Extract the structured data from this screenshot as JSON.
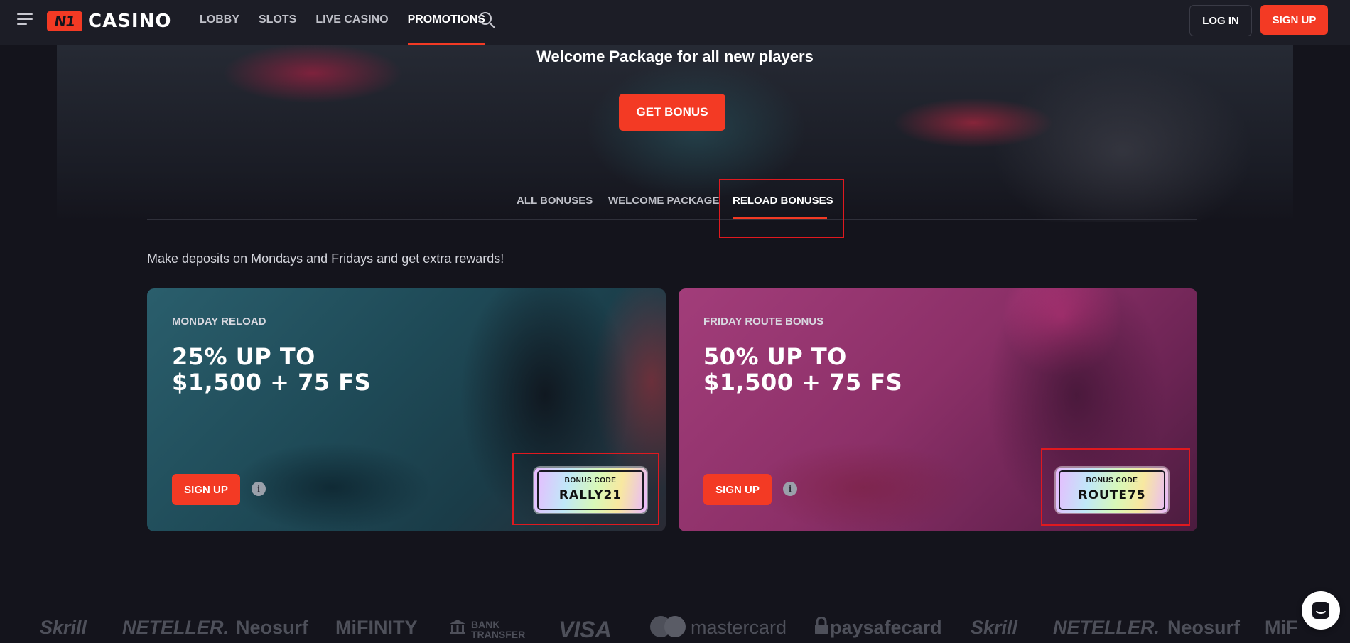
{
  "header": {
    "logo_badge": "N1",
    "logo_text": "CASINO",
    "nav": [
      "LOBBY",
      "SLOTS",
      "LIVE CASINO",
      "PROMOTIONS"
    ],
    "active_nav": "PROMOTIONS",
    "login_label": "LOG IN",
    "signup_label": "SIGN UP"
  },
  "hero": {
    "title": "Welcome Package for all new players",
    "cta_label": "GET BONUS"
  },
  "tabs": [
    {
      "label": "ALL BONUSES",
      "active": false
    },
    {
      "label": "WELCOME PACKAGE",
      "active": false
    },
    {
      "label": "RELOAD BONUSES",
      "active": true
    }
  ],
  "intro_text": "Make deposits on Mondays and Fridays and get extra rewards!",
  "cards": [
    {
      "label": "MONDAY RELOAD",
      "title_line1": "25% UP TO",
      "title_line2": "$1,500 + 75 FS",
      "signup_label": "SIGN UP",
      "info_icon": "i",
      "code_caption": "BONUS CODE",
      "code": "RALLY21"
    },
    {
      "label": "FRIDAY ROUTE BONUS",
      "title_line1": "50% UP TO",
      "title_line2": "$1,500 + 75 FS",
      "signup_label": "SIGN UP",
      "info_icon": "i",
      "code_caption": "BONUS CODE",
      "code": "ROUTE75"
    }
  ],
  "payments": [
    "Skrill",
    "NETELLER.",
    "Neosurf",
    "MiFINITY",
    "BANK TRANSFER",
    "VISA",
    "mastercard",
    "paysafecard",
    "Skrill",
    "NETELLER.",
    "Neosurf",
    "MiF"
  ],
  "colors": {
    "accent": "#f33a24",
    "background": "#14141c",
    "header": "#1c1d26",
    "highlight": "#e0191f"
  },
  "icons": {
    "menu": "hamburger-icon",
    "search": "search-icon",
    "info": "info-icon",
    "chat": "chat-icon",
    "bank": "bank-icon",
    "lock": "lock-icon"
  }
}
